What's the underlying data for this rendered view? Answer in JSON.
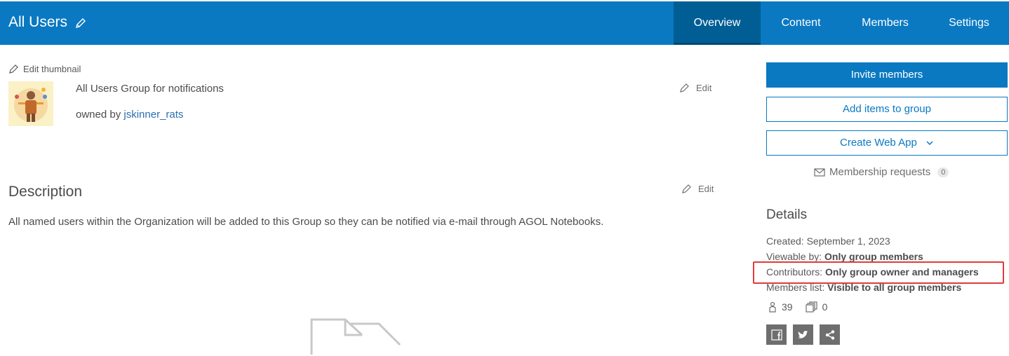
{
  "header": {
    "title": "All Users",
    "tabs": [
      {
        "label": "Overview",
        "active": true
      },
      {
        "label": "Content",
        "active": false
      },
      {
        "label": "Members",
        "active": false
      },
      {
        "label": "Settings",
        "active": false
      }
    ]
  },
  "group": {
    "edit_thumbnail_label": "Edit thumbnail",
    "summary": "All Users Group for notifications",
    "owned_by_prefix": "owned by",
    "owner": "jskinner_rats",
    "edit_label": "Edit"
  },
  "description": {
    "heading": "Description",
    "edit_label": "Edit",
    "text": "All named users within the Organization will be added to this Group so they can be notified via e-mail through AGOL Notebooks."
  },
  "sidebar": {
    "invite_members": "Invite members",
    "add_items": "Add items to group",
    "create_web_app": "Create Web App",
    "membership_requests": "Membership requests",
    "membership_requests_count": "0",
    "details_heading": "Details",
    "created_label": "Created:",
    "created_value": "September 1, 2023",
    "viewable_label": "Viewable by:",
    "viewable_value": "Only group members",
    "contributors_label": "Contributors:",
    "contributors_value": "Only group owner and managers",
    "members_list_label": "Members list:",
    "members_list_value": "Visible to all group members",
    "member_count": "39",
    "item_count": "0"
  },
  "colors": {
    "header_bg": "#0a79c2",
    "active_tab_bg": "#005e95",
    "link": "#2b6fb0",
    "highlight": "#e23b3b"
  },
  "icons": {
    "title_edit": "pencil-icon",
    "membership": "envelope-icon",
    "members": "user-icon",
    "items": "items-stack-icon",
    "share": [
      "facebook-icon",
      "twitter-icon",
      "share-icon"
    ]
  }
}
